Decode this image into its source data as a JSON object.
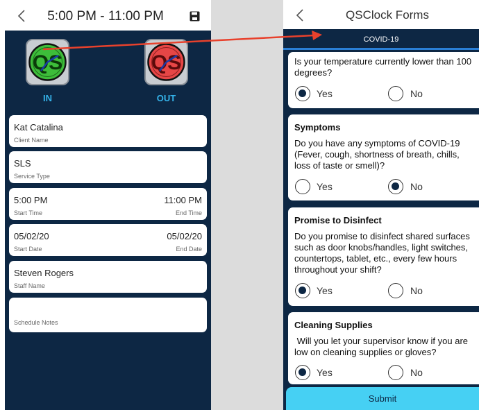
{
  "left_screen": {
    "header": {
      "time_range": "5:00 PM - 11:00 PM",
      "back_icon": "chevron-left-icon",
      "save_icon": "floppy-disk-icon"
    },
    "clock_in": {
      "label": "IN",
      "icon": "qs-clock-green-icon",
      "color": "#3dbd3a"
    },
    "clock_out": {
      "label": "OUT",
      "icon": "qs-clock-red-icon",
      "color": "#e64646"
    },
    "fields": {
      "client": {
        "value": "Kat Catalina",
        "caption": "Client Name"
      },
      "service": {
        "value": "SLS",
        "caption": "Service Type"
      },
      "start_time": {
        "value": "5:00 PM",
        "caption": "Start Time"
      },
      "end_time": {
        "value": "11:00 PM",
        "caption": "End Time"
      },
      "start_date": {
        "value": "05/02/20",
        "caption": "Start Date"
      },
      "end_date": {
        "value": "05/02/20",
        "caption": "End Date"
      },
      "staff": {
        "value": "Steven Rogers",
        "caption": "Staff Name"
      },
      "notes": {
        "value": "",
        "caption": "Schedule Notes"
      }
    }
  },
  "right_screen": {
    "header": {
      "title": "QSClock Forms",
      "back_icon": "chevron-left-icon"
    },
    "section_tab": "COVID-19",
    "questions": [
      {
        "title": "",
        "text": "Is your temperature currently lower than 100 degrees?",
        "yes": "Yes",
        "no": "No",
        "selected": "Yes"
      },
      {
        "title": "Symptoms",
        "text": "Do you have any symptoms of COVID-19 (Fever, cough, shortness of breath, chills, loss of taste or smell)?",
        "yes": "Yes",
        "no": "No",
        "selected": "No"
      },
      {
        "title": "Promise to Disinfect",
        "text": "Do you promise to disinfect shared surfaces such as door knobs/handles, light switches, countertops, tablet, etc., every few hours throughout your shift?",
        "yes": "Yes",
        "no": "No",
        "selected": "Yes"
      },
      {
        "title": "Cleaning Supplies",
        "text": " Will you let your supervisor know if you are low on cleaning supplies or gloves?",
        "yes": "Yes",
        "no": "No",
        "selected": "Yes"
      }
    ],
    "submit_label": "Submit"
  },
  "colors": {
    "navy": "#0d2744",
    "accent_blue": "#35b3ea",
    "submit": "#46d0f3",
    "arrow": "#e8412c"
  }
}
